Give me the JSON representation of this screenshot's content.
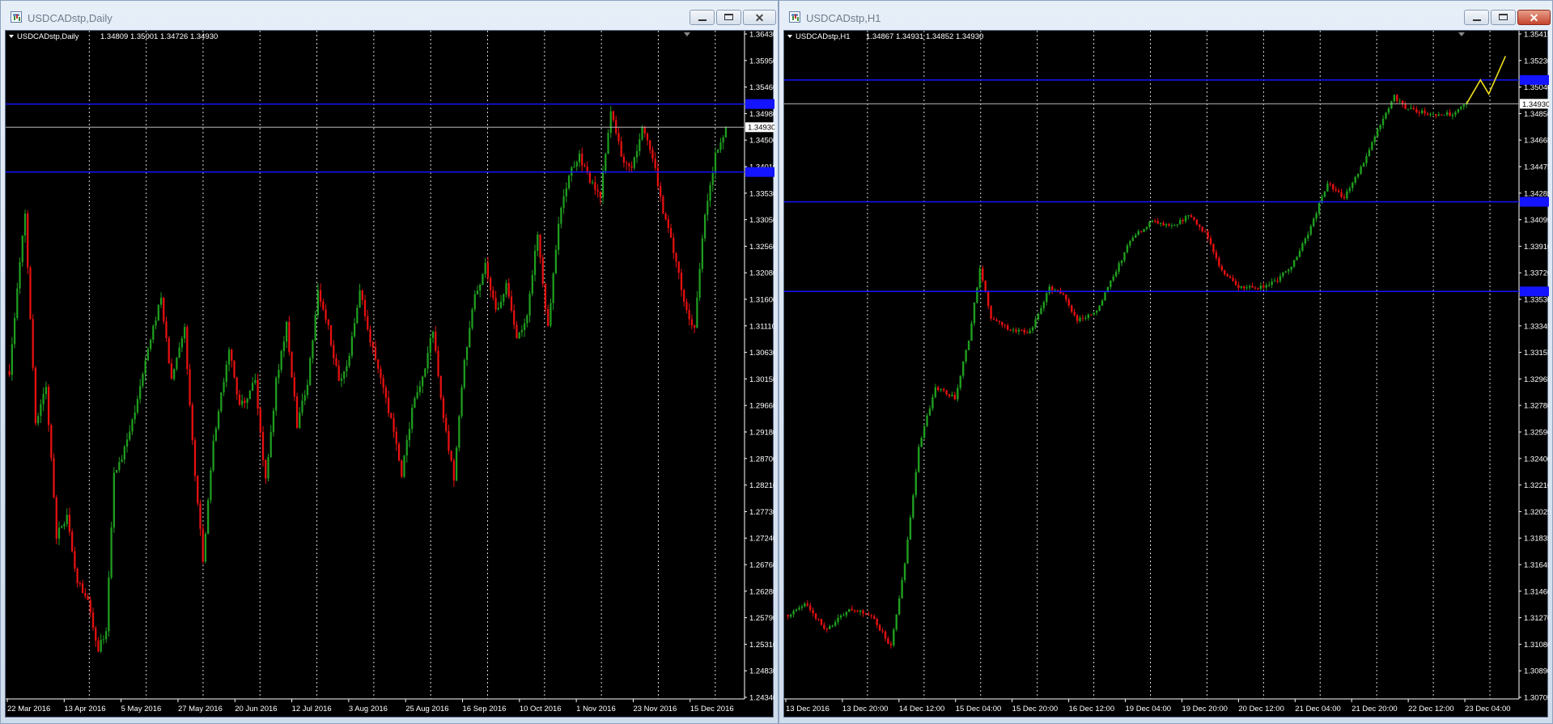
{
  "windows": [
    {
      "title": "USDCADstp,Daily",
      "active": false
    },
    {
      "title": "USDCADstp,H1",
      "active": true
    }
  ],
  "colors": {
    "background": "#000000",
    "bull": "#1f9e1f",
    "bear": "#e81010",
    "level_line": "#1414ff",
    "price_line": "#bbbbbb",
    "grid": "#d8d8d8",
    "projection": "#f0e020"
  },
  "chart_data": [
    {
      "type": "candlestick",
      "symbol": "USDCADstp",
      "timeframe": "Daily",
      "info_label": "USDCADstp,Daily",
      "ohlc_label": "1.34809 1.35001 1.34726 1.34930",
      "current_price_label": "1.34930",
      "current_price": 1.3493,
      "horizontal_levels": [
        1.3537,
        1.3408
      ],
      "ylim": [
        1.2408,
        1.3673
      ],
      "y_ticks": [
        "1.36430",
        "1.35950",
        "1.35460",
        "1.34980",
        "1.34500",
        "1.34010",
        "1.33530",
        "1.33050",
        "1.32560",
        "1.32080",
        "1.31600",
        "1.31110",
        "1.30630",
        "1.30150",
        "1.29660",
        "1.29180",
        "1.28700",
        "1.28210",
        "1.27730",
        "1.27240",
        "1.26760",
        "1.26280",
        "1.25790",
        "1.25310",
        "1.24830",
        "1.24340"
      ],
      "x_ticks": [
        "22 Mar 2016",
        "13 Apr 2016",
        "5 May 2016",
        "27 May 2016",
        "20 Jun 2016",
        "12 Jul 2016",
        "3 Aug 2016",
        "25 Aug 2016",
        "16 Sep 2016",
        "10 Oct 2016",
        "1 Nov 2016",
        "23 Nov 2016",
        "15 Dec 2016"
      ],
      "close_path": [
        [
          0,
          1.303
        ],
        [
          6,
          1.333
        ],
        [
          10,
          1.293
        ],
        [
          14,
          1.3
        ],
        [
          18,
          1.272
        ],
        [
          22,
          1.275
        ],
        [
          26,
          1.263
        ],
        [
          30,
          1.26
        ],
        [
          34,
          1.25
        ],
        [
          37,
          1.254
        ],
        [
          40,
          1.283
        ],
        [
          46,
          1.291
        ],
        [
          52,
          1.305
        ],
        [
          58,
          1.317
        ],
        [
          62,
          1.301
        ],
        [
          67,
          1.311
        ],
        [
          71,
          1.283
        ],
        [
          74,
          1.267
        ],
        [
          78,
          1.29
        ],
        [
          84,
          1.307
        ],
        [
          88,
          1.296
        ],
        [
          94,
          1.301
        ],
        [
          98,
          1.282
        ],
        [
          102,
          1.301
        ],
        [
          106,
          1.312
        ],
        [
          110,
          1.293
        ],
        [
          114,
          1.301
        ],
        [
          118,
          1.318
        ],
        [
          122,
          1.311
        ],
        [
          126,
          1.301
        ],
        [
          130,
          1.306
        ],
        [
          134,
          1.318
        ],
        [
          138,
          1.309
        ],
        [
          142,
          1.301
        ],
        [
          146,
          1.294
        ],
        [
          150,
          1.283
        ],
        [
          154,
          1.296
        ],
        [
          158,
          1.302
        ],
        [
          162,
          1.311
        ],
        [
          166,
          1.294
        ],
        [
          170,
          1.283
        ],
        [
          174,
          1.305
        ],
        [
          178,
          1.317
        ],
        [
          182,
          1.323
        ],
        [
          186,
          1.314
        ],
        [
          190,
          1.319
        ],
        [
          194,
          1.309
        ],
        [
          198,
          1.314
        ],
        [
          202,
          1.329
        ],
        [
          206,
          1.311
        ],
        [
          210,
          1.331
        ],
        [
          214,
          1.34
        ],
        [
          218,
          1.344
        ],
        [
          222,
          1.339
        ],
        [
          226,
          1.336
        ],
        [
          230,
          1.353
        ],
        [
          234,
          1.344
        ],
        [
          238,
          1.341
        ],
        [
          242,
          1.349
        ],
        [
          246,
          1.344
        ],
        [
          250,
          1.333
        ],
        [
          254,
          1.326
        ],
        [
          258,
          1.316
        ],
        [
          262,
          1.311
        ],
        [
          266,
          1.333
        ],
        [
          270,
          1.344
        ],
        [
          274,
          1.3493
        ]
      ]
    },
    {
      "type": "candlestick",
      "symbol": "USDCADstp",
      "timeframe": "H1",
      "info_label": "USDCADstp,H1",
      "ohlc_label": "1.34867 1.34931 1.34852 1.34930",
      "current_price_label": "1.34930",
      "current_price": 1.3493,
      "horizontal_levels": [
        1.351,
        1.3423,
        1.3359
      ],
      "ylim": [
        1.3068,
        1.3544
      ],
      "y_ticks": [
        "1.35415",
        "1.35230",
        "1.35040",
        "1.34850",
        "1.34665",
        "1.34475",
        "1.34285",
        "1.34095",
        "1.33910",
        "1.33720",
        "1.33530",
        "1.33345",
        "1.33155",
        "1.32965",
        "1.32780",
        "1.32590",
        "1.32400",
        "1.32210",
        "1.32025",
        "1.31835",
        "1.31645",
        "1.31460",
        "1.31270",
        "1.31080",
        "1.30890",
        "1.30705"
      ],
      "x_ticks": [
        "13 Dec 2016",
        "13 Dec 20:00",
        "14 Dec 12:00",
        "15 Dec 04:00",
        "15 Dec 20:00",
        "16 Dec 12:00",
        "19 Dec 04:00",
        "19 Dec 20:00",
        "20 Dec 12:00",
        "21 Dec 04:00",
        "21 Dec 20:00",
        "22 Dec 12:00",
        "23 Dec 04:00"
      ],
      "close_path": [
        [
          0,
          1.3128
        ],
        [
          6,
          1.3136
        ],
        [
          14,
          1.3117
        ],
        [
          22,
          1.3133
        ],
        [
          30,
          1.3128
        ],
        [
          37,
          1.3105
        ],
        [
          42,
          1.3165
        ],
        [
          47,
          1.3248
        ],
        [
          53,
          1.329
        ],
        [
          60,
          1.3283
        ],
        [
          65,
          1.3325
        ],
        [
          69,
          1.3375
        ],
        [
          73,
          1.334
        ],
        [
          80,
          1.3332
        ],
        [
          87,
          1.333
        ],
        [
          94,
          1.3362
        ],
        [
          99,
          1.3357
        ],
        [
          104,
          1.3338
        ],
        [
          111,
          1.3345
        ],
        [
          117,
          1.337
        ],
        [
          123,
          1.3395
        ],
        [
          131,
          1.341
        ],
        [
          138,
          1.3405
        ],
        [
          144,
          1.3413
        ],
        [
          150,
          1.3401
        ],
        [
          156,
          1.3373
        ],
        [
          162,
          1.3362
        ],
        [
          169,
          1.3361
        ],
        [
          176,
          1.3367
        ],
        [
          182,
          1.338
        ],
        [
          188,
          1.3405
        ],
        [
          194,
          1.3437
        ],
        [
          200,
          1.3426
        ],
        [
          206,
          1.3447
        ],
        [
          212,
          1.3475
        ],
        [
          218,
          1.3498
        ],
        [
          222,
          1.349
        ],
        [
          228,
          1.3487
        ],
        [
          234,
          1.3485
        ],
        [
          240,
          1.3486
        ],
        [
          244,
          1.3493
        ]
      ],
      "projection_path": [
        [
          244,
          1.3493
        ],
        [
          249,
          1.351
        ],
        [
          252,
          1.35
        ],
        [
          258,
          1.3527
        ]
      ]
    }
  ]
}
